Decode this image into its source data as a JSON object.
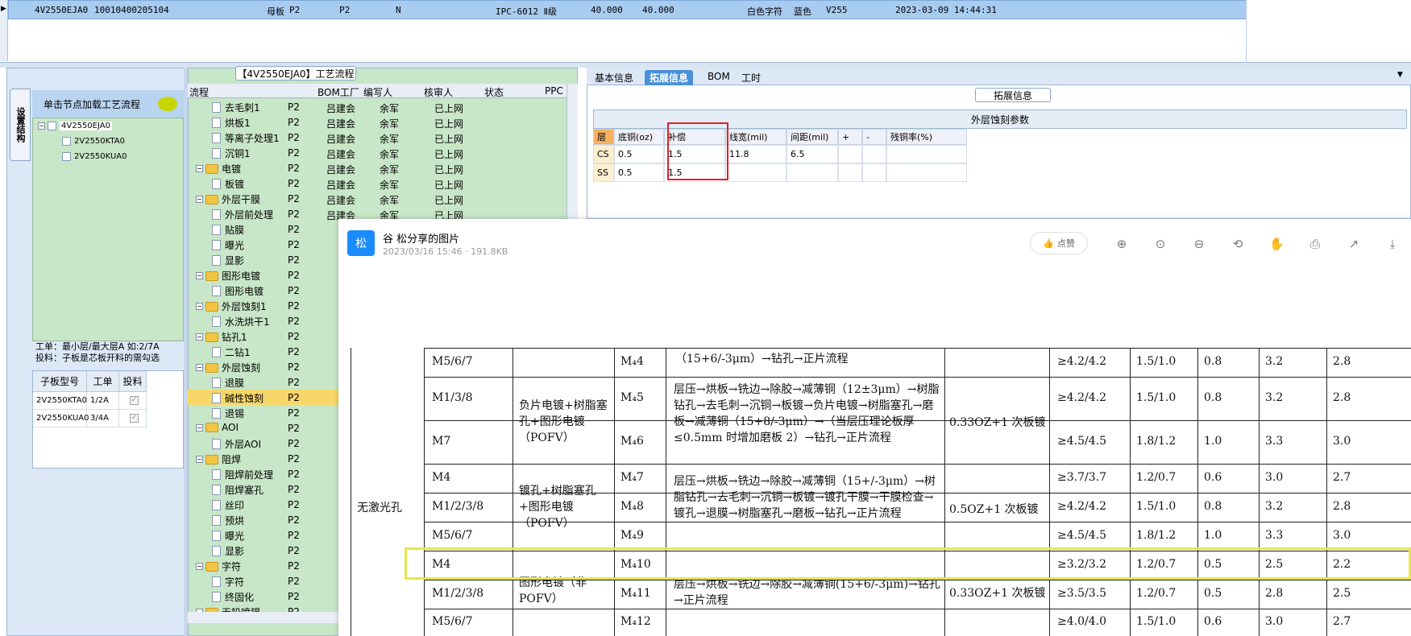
{
  "top_grid": {
    "row": {
      "code": "4V2550EJA0",
      "number": "10010400205104",
      "type": "母板",
      "factory": "P2",
      "factory2": "P2",
      "flag": "N",
      "standard": "IPC-6012 Ⅱ级",
      "v1": "40.000",
      "v2": "40.000",
      "silk": "白色字符",
      "mask": "蓝色",
      "grade": "V255",
      "date": "2023-03-09 14:44:31"
    }
  },
  "left": {
    "vtab": "设置结构",
    "header": "单击节点加载工艺流程",
    "tree": [
      "4V2550EJA0",
      "2V2550KTA0",
      "2V2550KUA0"
    ],
    "info_line1": "工单：最小层/最大层A 如:2/7A",
    "info_line2": "投料：子板是芯板开料的需勾选",
    "table_headers": [
      "子板型号",
      "工单",
      "投料"
    ],
    "table_rows": [
      {
        "model": "2V2550KTA0",
        "order": "1/2A",
        "feed": "✓"
      },
      {
        "model": "2V2550KUA0",
        "order": "3/4A",
        "feed": "✓"
      }
    ]
  },
  "process": {
    "title": "【4V2550EJA0】工艺流程",
    "headers": [
      "流程",
      "BOM工厂",
      "编写人",
      "核审人",
      "状态",
      "PPC"
    ],
    "rows": [
      {
        "level": 2,
        "kind": "doc",
        "name": "去毛刺1",
        "factory": "P2",
        "writer": "吕建会",
        "reviewer": "余军",
        "status": "已上网"
      },
      {
        "level": 2,
        "kind": "doc",
        "name": "烘板1",
        "factory": "P2",
        "writer": "吕建会",
        "reviewer": "余军",
        "status": "已上网"
      },
      {
        "level": 2,
        "kind": "doc",
        "name": "等离子处理1",
        "factory": "P2",
        "writer": "吕建会",
        "reviewer": "余军",
        "status": "已上网"
      },
      {
        "level": 2,
        "kind": "doc",
        "name": "沉铜1",
        "factory": "P2",
        "writer": "吕建会",
        "reviewer": "余军",
        "status": "已上网"
      },
      {
        "level": 1,
        "kind": "folder",
        "name": "电镀",
        "factory": "P2",
        "writer": "吕建会",
        "reviewer": "余军",
        "status": "已上网"
      },
      {
        "level": 2,
        "kind": "doc",
        "name": "板镀",
        "factory": "P2",
        "writer": "吕建会",
        "reviewer": "余军",
        "status": "已上网"
      },
      {
        "level": 1,
        "kind": "folder",
        "name": "外层干膜",
        "factory": "P2",
        "writer": "吕建会",
        "reviewer": "余军",
        "status": "已上网"
      },
      {
        "level": 2,
        "kind": "doc",
        "name": "外层前处理",
        "factory": "P2",
        "writer": "吕建会",
        "reviewer": "余军",
        "status": "已上网"
      },
      {
        "level": 2,
        "kind": "doc",
        "name": "贴膜",
        "factory": "P2",
        "writer": "",
        "reviewer": "",
        "status": ""
      },
      {
        "level": 2,
        "kind": "doc",
        "name": "曝光",
        "factory": "P2",
        "writer": "",
        "reviewer": "",
        "status": ""
      },
      {
        "level": 2,
        "kind": "doc",
        "name": "显影",
        "factory": "P2",
        "writer": "",
        "reviewer": "",
        "status": ""
      },
      {
        "level": 1,
        "kind": "folder",
        "name": "图形电镀",
        "factory": "P2",
        "writer": "",
        "reviewer": "",
        "status": ""
      },
      {
        "level": 2,
        "kind": "doc",
        "name": "图形电镀",
        "factory": "P2",
        "writer": "",
        "reviewer": "",
        "status": ""
      },
      {
        "level": 1,
        "kind": "folder",
        "name": "外层蚀刻1",
        "factory": "P2",
        "writer": "",
        "reviewer": "",
        "status": ""
      },
      {
        "level": 2,
        "kind": "doc",
        "name": "水洗烘干1",
        "factory": "P2",
        "writer": "",
        "reviewer": "",
        "status": ""
      },
      {
        "level": 1,
        "kind": "folder",
        "name": "钻孔1",
        "factory": "P2",
        "writer": "",
        "reviewer": "",
        "status": ""
      },
      {
        "level": 2,
        "kind": "doc",
        "name": "二钻1",
        "factory": "P2",
        "writer": "",
        "reviewer": "",
        "status": ""
      },
      {
        "level": 1,
        "kind": "folder",
        "name": "外层蚀刻",
        "factory": "P2",
        "writer": "",
        "reviewer": "",
        "status": ""
      },
      {
        "level": 2,
        "kind": "doc",
        "name": "退膜",
        "factory": "P2",
        "writer": "",
        "reviewer": "",
        "status": ""
      },
      {
        "level": 2,
        "kind": "doc",
        "name": "碱性蚀刻",
        "factory": "P2",
        "writer": "",
        "reviewer": "",
        "status": "",
        "selected": true
      },
      {
        "level": 2,
        "kind": "doc",
        "name": "退锡",
        "factory": "P2",
        "writer": "",
        "reviewer": "",
        "status": ""
      },
      {
        "level": 1,
        "kind": "folder",
        "name": "AOI",
        "factory": "P2",
        "writer": "",
        "reviewer": "",
        "status": ""
      },
      {
        "level": 2,
        "kind": "doc",
        "name": "外层AOI",
        "factory": "P2",
        "writer": "",
        "reviewer": "",
        "status": ""
      },
      {
        "level": 1,
        "kind": "folder",
        "name": "阻焊",
        "factory": "P2",
        "writer": "",
        "reviewer": "",
        "status": ""
      },
      {
        "level": 2,
        "kind": "doc",
        "name": "阻焊前处理",
        "factory": "P2",
        "writer": "",
        "reviewer": "",
        "status": ""
      },
      {
        "level": 2,
        "kind": "doc",
        "name": "阻焊塞孔",
        "factory": "P2",
        "writer": "",
        "reviewer": "",
        "status": ""
      },
      {
        "level": 2,
        "kind": "doc",
        "name": "丝印",
        "factory": "P2",
        "writer": "",
        "reviewer": "",
        "status": ""
      },
      {
        "level": 2,
        "kind": "doc",
        "name": "预烘",
        "factory": "P2",
        "writer": "",
        "reviewer": "",
        "status": ""
      },
      {
        "level": 2,
        "kind": "doc",
        "name": "曝光",
        "factory": "P2",
        "writer": "",
        "reviewer": "",
        "status": ""
      },
      {
        "level": 2,
        "kind": "doc",
        "name": "显影",
        "factory": "P2",
        "writer": "",
        "reviewer": "",
        "status": ""
      },
      {
        "level": 1,
        "kind": "folder",
        "name": "字符",
        "factory": "P2",
        "writer": "",
        "reviewer": "",
        "status": ""
      },
      {
        "level": 2,
        "kind": "doc",
        "name": "字符",
        "factory": "P2",
        "writer": "",
        "reviewer": "",
        "status": ""
      },
      {
        "level": 2,
        "kind": "doc",
        "name": "终固化",
        "factory": "P2",
        "writer": "",
        "reviewer": "",
        "status": ""
      },
      {
        "level": 1,
        "kind": "folder",
        "name": "无铅喷锡",
        "factory": "P2",
        "writer": "",
        "reviewer": "",
        "status": ""
      }
    ]
  },
  "right": {
    "tabs": [
      "基本信息",
      "拓展信息",
      "BOM",
      "工时"
    ],
    "active_tab": "拓展信息",
    "group_label": "拓展信息",
    "etch_title": "外层蚀刻参数",
    "etch_headers": [
      "层",
      "底铜(oz)",
      "补偿",
      "线宽(mil)",
      "间距(mil)",
      "+",
      "-",
      "残铜率(%)"
    ],
    "etch_rows": [
      [
        "CS",
        "0.5",
        "1.5",
        "11.8",
        "6.5",
        "",
        "",
        ""
      ],
      [
        "SS",
        "0.5",
        "1.5",
        "",
        "",
        "",
        "",
        ""
      ]
    ]
  },
  "viewer": {
    "avatar": "松",
    "title": "谷 松分享的图片",
    "meta": "2023/03/16 15:46 · 191.8KB",
    "like": "点赞",
    "toolbar_icons": [
      "zoom-in-icon",
      "fit-icon",
      "zoom-out-icon",
      "rotate-icon",
      "hand-icon",
      "print-icon",
      "share-icon",
      "download-icon"
    ],
    "doc": {
      "group_label": "无激光孔",
      "rows": [
        {
          "layers": "M5/6/7",
          "id": "M₄4",
          "right": [
            "≥4.2/4.2",
            "1.5/1.0",
            "0.8",
            "3.2",
            "2.8"
          ]
        },
        {
          "layers": "M1/3/8",
          "id": "M₄5",
          "right": [
            "≥4.2/4.2",
            "1.5/1.0",
            "0.8",
            "3.2",
            "2.8"
          ]
        },
        {
          "layers": "M7",
          "id": "M₄6",
          "right": [
            "≥4.5/4.5",
            "1.8/1.2",
            "1.0",
            "3.3",
            "3.0"
          ]
        },
        {
          "layers": "M4",
          "id": "M₄7",
          "right": [
            "≥3.7/3.7",
            "1.2/0.7",
            "0.6",
            "3.0",
            "2.7"
          ]
        },
        {
          "layers": "M1/2/3/8",
          "id": "M₄8",
          "right": [
            "≥4.2/4.2",
            "1.5/1.0",
            "0.8",
            "3.2",
            "2.8"
          ]
        },
        {
          "layers": "M5/6/7",
          "id": "M₄9",
          "right": [
            "≥4.5/4.5",
            "1.8/1.2",
            "1.0",
            "3.3",
            "3.0"
          ]
        },
        {
          "layers": "M4",
          "id": "M₄10",
          "right": [
            "≥3.2/3.2",
            "1.2/0.7",
            "0.5",
            "2.5",
            "2.2"
          ]
        },
        {
          "layers": "M1/2/3/8",
          "id": "M₄11",
          "right": [
            "≥3.5/3.5",
            "1.2/0.7",
            "0.5",
            "2.8",
            "2.5"
          ]
        },
        {
          "layers": "M5/6/7",
          "id": "M₄12",
          "right": [
            "≥4.0/4.0",
            "1.5/1.0",
            "0.6",
            "3.0",
            "2.7"
          ]
        }
      ],
      "process_a_title": "负片电镀+树脂塞孔+图形电镀（POFV）",
      "process_a_flow": "层压→烘板→铣边→除胶→减薄铜（12±3μm）→树脂钻孔→去毛刺→沉铜→板镀→负片电镀→树脂塞孔→磨板→减薄铜（15+8/-3μm）→（当层压理论板厚≤0.5mm 时增加磨板 2）→钻孔→正片流程",
      "process_a_plating": "0.33OZ+1 次板镀",
      "process_b_title": "镀孔+树脂塞孔+图形电镀（POFV）",
      "process_b_flow": "层压→烘板→铣边→除胶→减薄铜（15+/-3μm）→树脂钻孔→去毛刺→沉铜→板镀→镀孔干膜→干膜检查→镀孔→退膜→树脂塞孔→磨板→钻孔→正片流程",
      "process_b_plating": "0.5OZ+1 次板镀",
      "process_c_title": "图形电镀（非POFV）",
      "process_c_flow": "层压→烘板→铣边→除胶→减薄铜(15+6/-3μm)→钻孔→正片流程",
      "process_c_plating": "0.33OZ+1 次板镀",
      "top_flow_tail": "（15+6/-3μm）→钻孔→正片流程"
    }
  },
  "colors": {
    "selected_row": "#a8cbf0",
    "tree_bg": "#c8e6c8",
    "active_tab": "#4a90d9",
    "red_highlight": "#e0202a",
    "yellow_highlight": "#e6e84a",
    "avatar": "#1a8cff"
  }
}
